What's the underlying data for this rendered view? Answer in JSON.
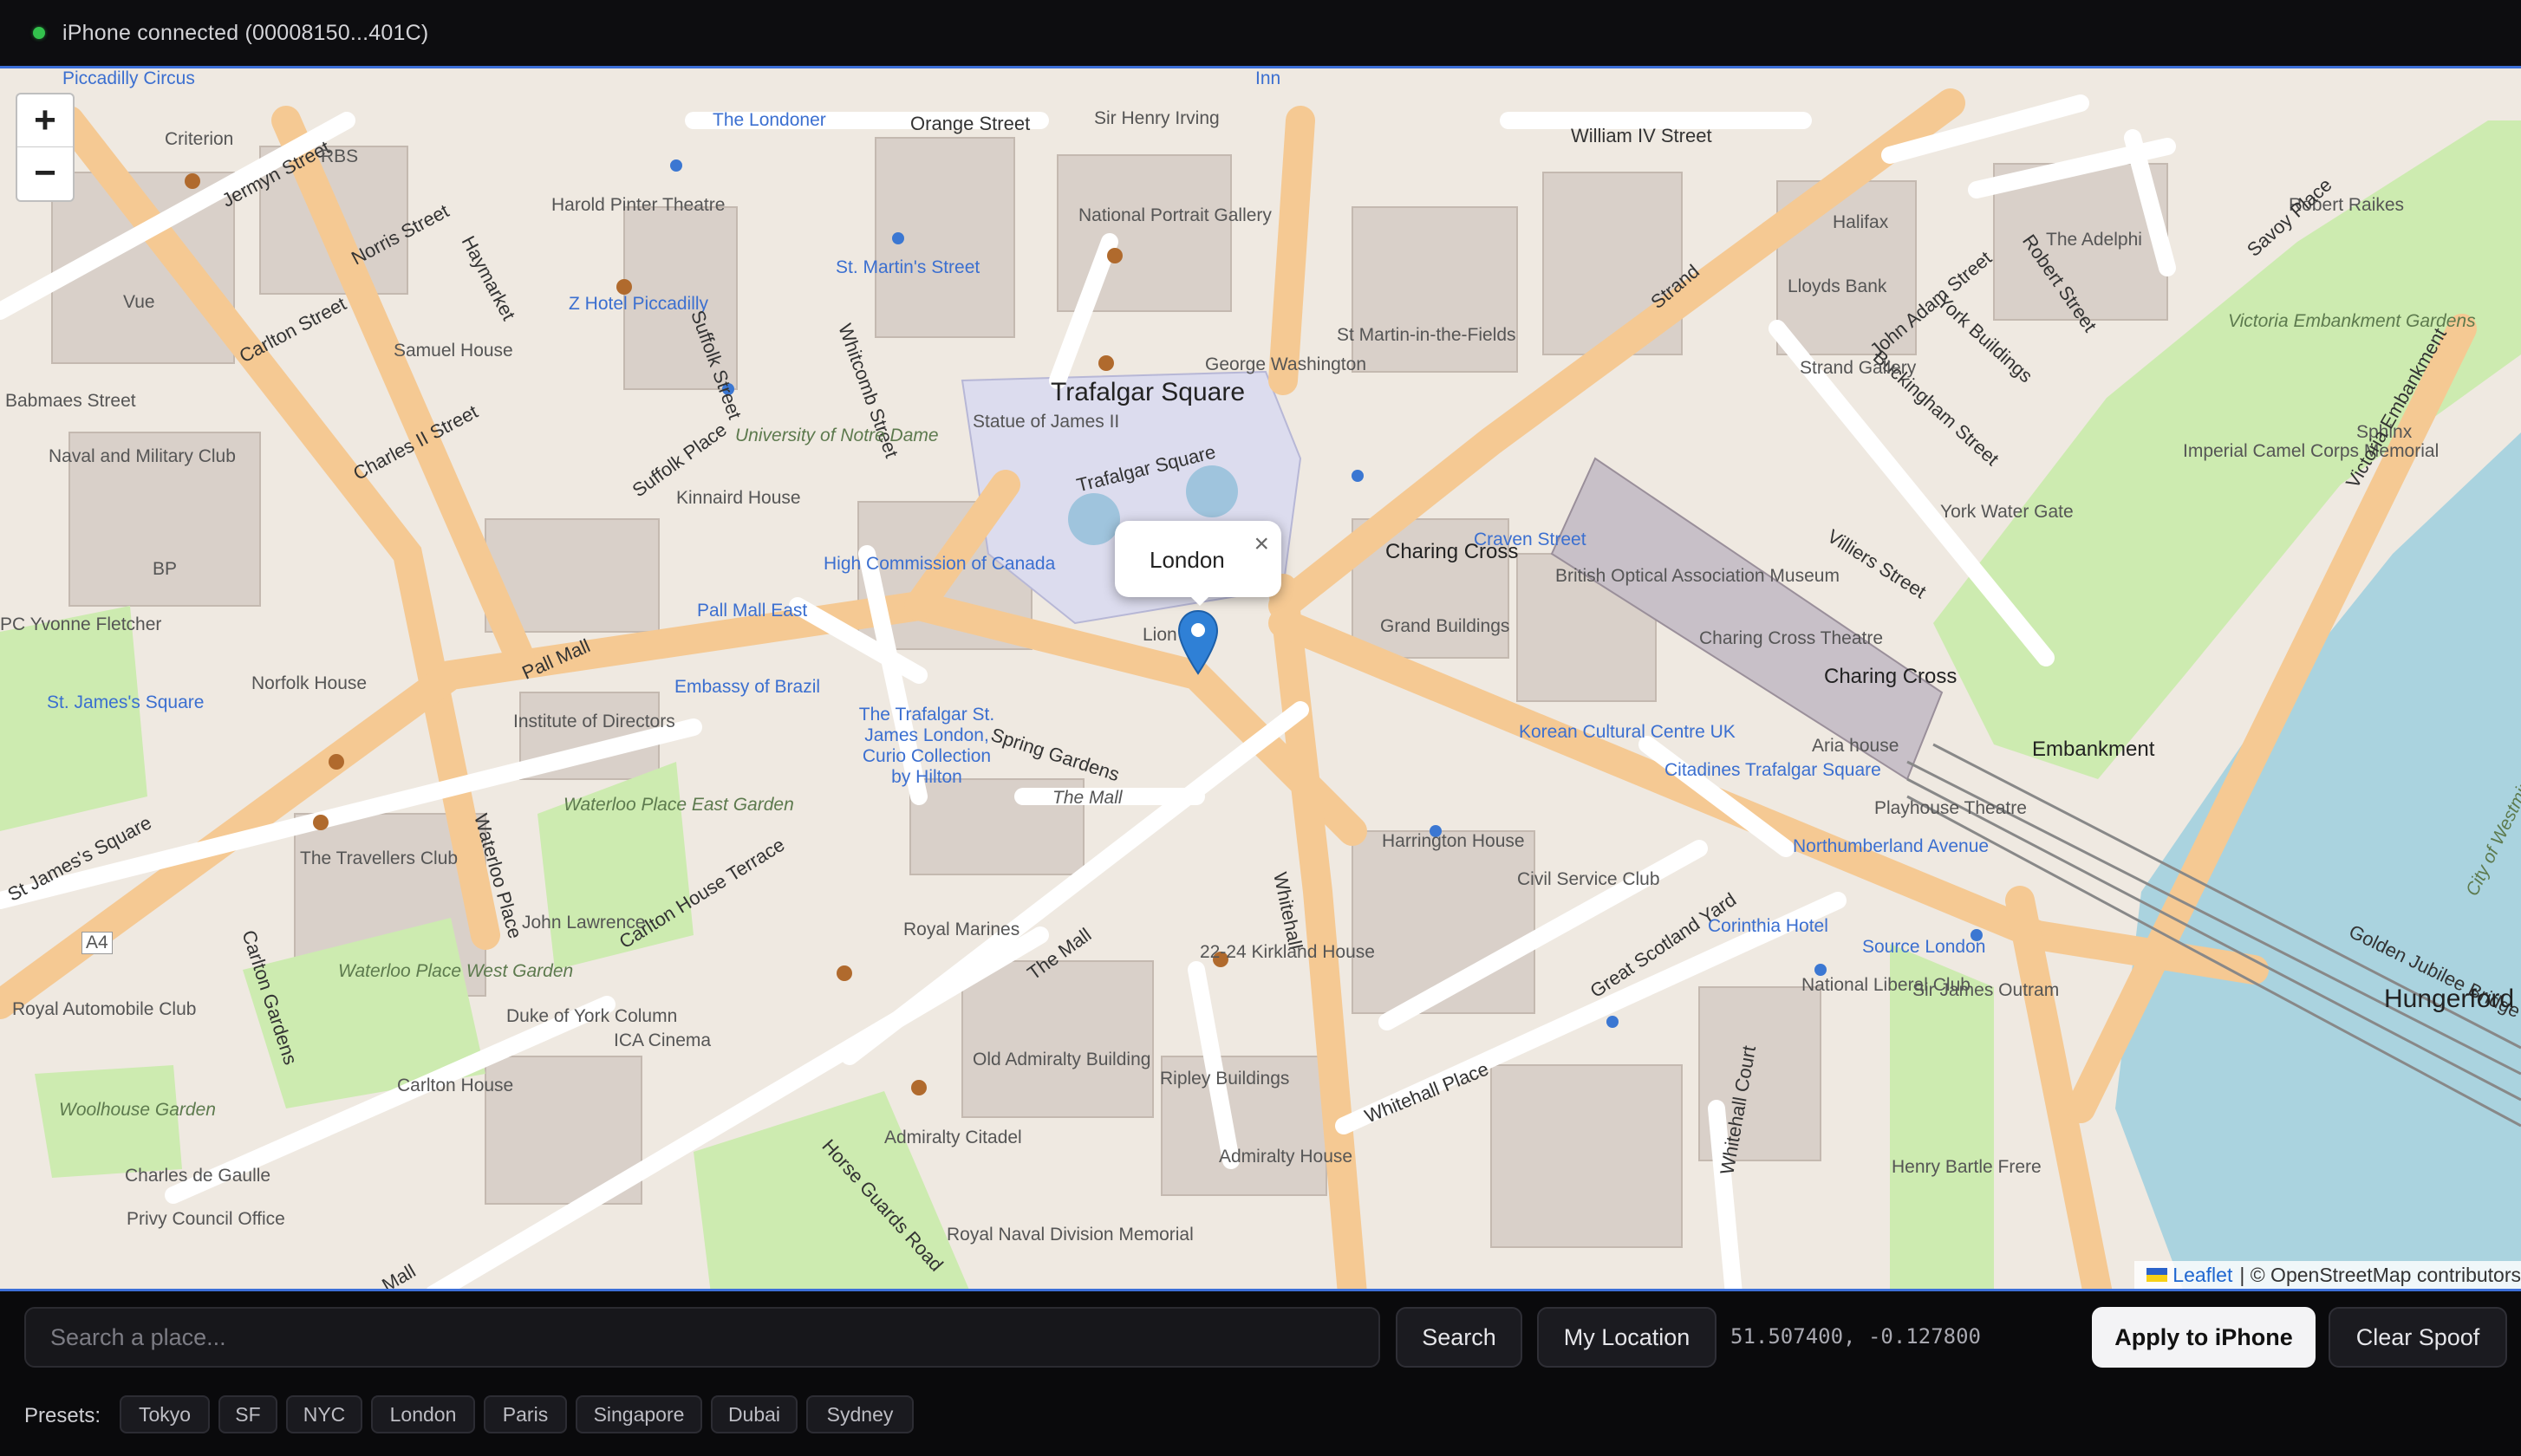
{
  "status": {
    "text": "iPhone connected (00008150...401C)",
    "dot_color": "#33c24d"
  },
  "map": {
    "zoom_in": "+",
    "zoom_out": "−",
    "popup": {
      "title": "London",
      "close": "×"
    },
    "attribution": {
      "leaflet": "Leaflet",
      "rest": "| © OpenStreetMap contributors"
    },
    "labels": {
      "piccadilly_circus": "Piccadilly Circus",
      "criterion": "Criterion",
      "jermyn_street": "Jermyn Street",
      "orange_street": "Orange Street",
      "sir_henry_irving": "Sir Henry Irving",
      "william_iv_street": "William IV Street",
      "the_londoner": "The Londoner",
      "inn": "Inn",
      "rbs": "RBS",
      "harold_pinter": "Harold Pinter Theatre",
      "norris_street": "Norris Street",
      "haymarket": "Haymarket",
      "national_portrait": "National Portrait Gallery",
      "st_martins_street": "St. Martin's Street",
      "z_hotel": "Z Hotel Piccadilly",
      "suffolk_street": "Suffolk Street",
      "whitcomb_street": "Whitcomb Street",
      "vue": "Vue",
      "carlton_street": "Carlton Street",
      "samuel_house": "Samuel House",
      "babmaes": "Babmaes Street",
      "naval_military": "Naval and Military Club",
      "charles_ii_street": "Charles II Street",
      "uni_notre_dame": "University of Notre Dame",
      "suffolk_place": "Suffolk Place",
      "kinnaird_house": "Kinnaird House",
      "trafalgar_square": "Trafalgar Square",
      "trafalgar_square_road": "Trafalgar Square",
      "statue_james": "Statue of James II",
      "george_washington": "George Washington",
      "st_martin_fields": "St Martin-in-the-Fields",
      "strand": "Strand",
      "john_adam_street": "John Adam Street",
      "the_adelphi": "The Adelphi",
      "robert_street": "Robert Street",
      "york_buildings": "York Buildings",
      "buckingham_street": "Buckingham Street",
      "strand_gallery": "Strand Gallery",
      "lloyds_bank": "Lloyds Bank",
      "halifax": "Halifax",
      "victoria_embankment_gardens": "Victoria Embankment Gardens",
      "robert_raikes": "Robert Raikes",
      "savoy_place": "Savoy Place",
      "imperial_camel": "Imperial Camel Corps Memorial",
      "york_water_gate": "York Water Gate",
      "sphinx": "Sphinx",
      "victoria_embankment": "Victoria Embankment",
      "high_commission_canada": "High Commission of Canada",
      "charing_cross": "Charing Cross",
      "craven_street": "Craven Street",
      "british_optical": "British Optical Association Museum",
      "grand_buildings": "Grand Buildings",
      "villiers_street": "Villiers Street",
      "charing_cross_theatre": "Charing Cross Theatre",
      "charing_cross_station": "Charing Cross",
      "embankment": "Embankment",
      "bp": "BP",
      "yvonne_fletcher": "PC Yvonne Fletcher",
      "st_james_square": "St. James's Square",
      "norfolk_house": "Norfolk House",
      "pall_mall": "Pall Mall",
      "pall_mall_east": "Pall Mall East",
      "embassy_brazil": "Embassy of Brazil",
      "institute_directors": "Institute of Directors",
      "trafalgar_st_james": "The Trafalgar St. James London, Curio Collection by Hilton",
      "spring_gardens": "Spring Gardens",
      "the_mall": "The Mall",
      "lion": "Lion",
      "korean_cultural": "Korean Cultural Centre UK",
      "citadines": "Citadines Trafalgar Square",
      "aria_house": "Aria house",
      "playhouse": "Playhouse Theatre",
      "northumberland_avenue": "Northumberland Avenue",
      "harrington_house": "Harrington House",
      "civil_service_club": "Civil Service Club",
      "great_scotland_yard": "Great Scotland Yard",
      "whitehall": "Whitehall",
      "corinthia": "Corinthia Hotel",
      "source_london": "Source London",
      "national_liberal": "National Liberal Club",
      "golden_jubilee": "Golden Jubilee Bridge",
      "hungerford_bridge": "Hungerford Bridge",
      "st_james_square_street": "St James's Square",
      "the_travellers": "The Travellers Club",
      "waterloo_place": "Waterloo Place",
      "waterloo_east": "Waterloo Place East Garden",
      "carlton_house_terrace": "Carlton House Terrace",
      "john_lawrence": "John Lawrence",
      "royal_marines": "Royal Marines",
      "carlton_gardens": "Carlton Gardens",
      "waterloo_west": "Waterloo Place West Garden",
      "royal_automobile": "Royal Automobile Club",
      "duke_york": "Duke of York Column",
      "ica_cinema": "ICA Cinema",
      "old_admiralty": "Old Admiralty Building",
      "ripley": "Ripley Buildings",
      "kirkland_house": "22-24 Kirkland House",
      "whitehall_place": "Whitehall Place",
      "whitehall_court": "Whitehall Court",
      "sir_james_outram": "Sir James Outram",
      "henry_bartle_frere": "Henry Bartle Frere",
      "carlton_house": "Carlton House",
      "woolhouse": "Woolhouse Garden",
      "charles_de_gaulle": "Charles de Gaulle",
      "privy_council": "Privy Council Office",
      "admiralty_citadel": "Admiralty Citadel",
      "horse_guards_road": "Horse Guards Road",
      "admiralty_house": "Admiralty House",
      "royal_naval": "Royal Naval Division Memorial",
      "a4": "A4",
      "mall_small": "Mall",
      "city_westminster": "City of Westminster",
      "the_mall_2": "The Mall"
    }
  },
  "controls": {
    "search_placeholder": "Search a place...",
    "search_button": "Search",
    "my_location": "My Location",
    "coords": "51.507400, -0.127800",
    "apply": "Apply to iPhone",
    "clear": "Clear Spoof"
  },
  "presets": {
    "label": "Presets:",
    "items": [
      "Tokyo",
      "SF",
      "NYC",
      "London",
      "Paris",
      "Singapore",
      "Dubai",
      "Sydney"
    ]
  }
}
